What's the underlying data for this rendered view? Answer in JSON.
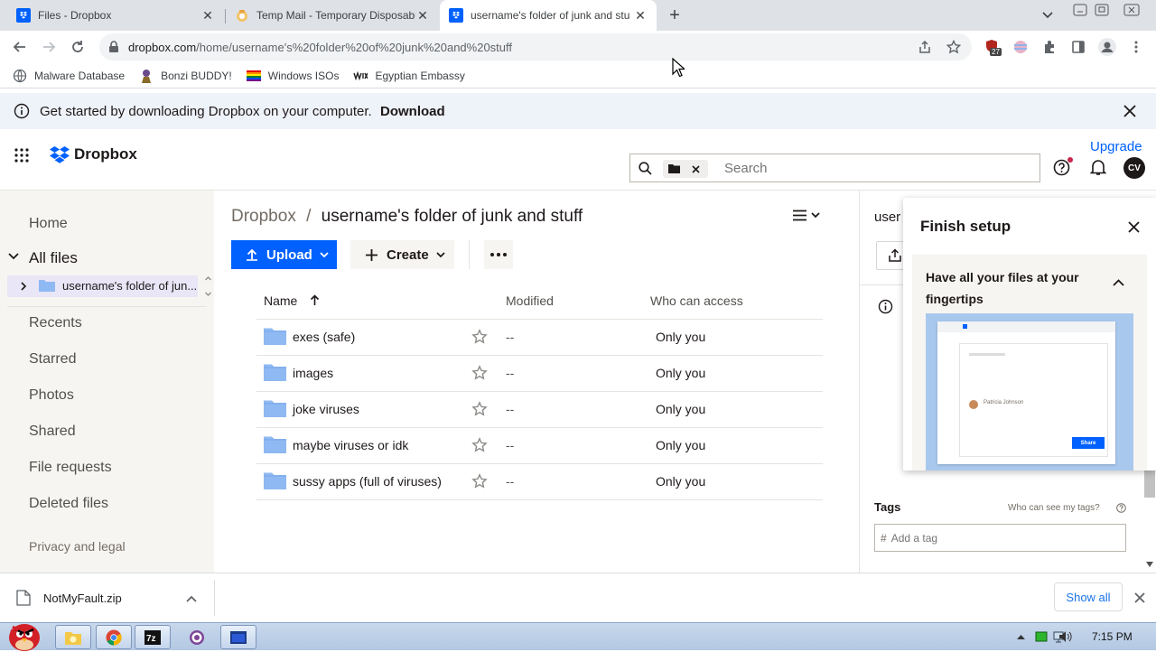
{
  "browser": {
    "tabs": [
      {
        "title": "Files - Dropbox"
      },
      {
        "title": "Temp Mail - Temporary Disposable"
      },
      {
        "title": "username's folder of junk and stu"
      }
    ],
    "url_host": "dropbox.com",
    "url_path": "/home/username's%20folder%20of%20junk%20and%20stuff",
    "extension_badge": "27",
    "bookmarks": [
      {
        "label": "Malware Database"
      },
      {
        "label": "Bonzi BUDDY!"
      },
      {
        "label": "Windows ISOs"
      },
      {
        "label": "Egyptian Embassy"
      }
    ]
  },
  "banner": {
    "text": "Get started by downloading Dropbox on your computer.",
    "link": "Download"
  },
  "header": {
    "brand": "Dropbox",
    "upgrade": "Upgrade",
    "search_placeholder": "Search",
    "avatar_initials": "CV"
  },
  "sidebar": {
    "home": "Home",
    "all_files": "All files",
    "tree_item": "username's folder of jun...",
    "items": [
      "Recents",
      "Starred",
      "Photos",
      "Shared",
      "File requests",
      "Deleted files"
    ],
    "privacy": "Privacy and legal"
  },
  "main": {
    "breadcrumb_root": "Dropbox",
    "breadcrumb_sep": "/",
    "breadcrumb_current": "username's folder of junk and stuff",
    "upload": "Upload",
    "create": "Create",
    "columns": {
      "name": "Name",
      "modified": "Modified",
      "access": "Who can access"
    },
    "rows": [
      {
        "name": "exes (safe)",
        "modified": "--",
        "access": "Only you"
      },
      {
        "name": "images",
        "modified": "--",
        "access": "Only you"
      },
      {
        "name": "joke viruses",
        "modified": "--",
        "access": "Only you"
      },
      {
        "name": "maybe viruses or idk",
        "modified": "--",
        "access": "Only you"
      },
      {
        "name": "sussy apps (full of viruses)",
        "modified": "--",
        "access": "Only you"
      }
    ]
  },
  "right_panel": {
    "title_partial": "user",
    "tags_label": "Tags",
    "tags_help": "Who can see my tags?",
    "tag_placeholder": "Add a tag"
  },
  "setup": {
    "title": "Finish setup",
    "card_title": "Have all your files at your fingertips",
    "preview_name": "Patricia Johnson",
    "preview_share": "Share"
  },
  "downloads": {
    "file": "NotMyFault.zip",
    "show_all": "Show all"
  },
  "taskbar": {
    "time": "7:15 PM"
  },
  "colors": {
    "accent": "#0061fe",
    "folder": "#8fb9f2",
    "banner": "#eef2f9",
    "sidebar": "#f7f5f2"
  }
}
